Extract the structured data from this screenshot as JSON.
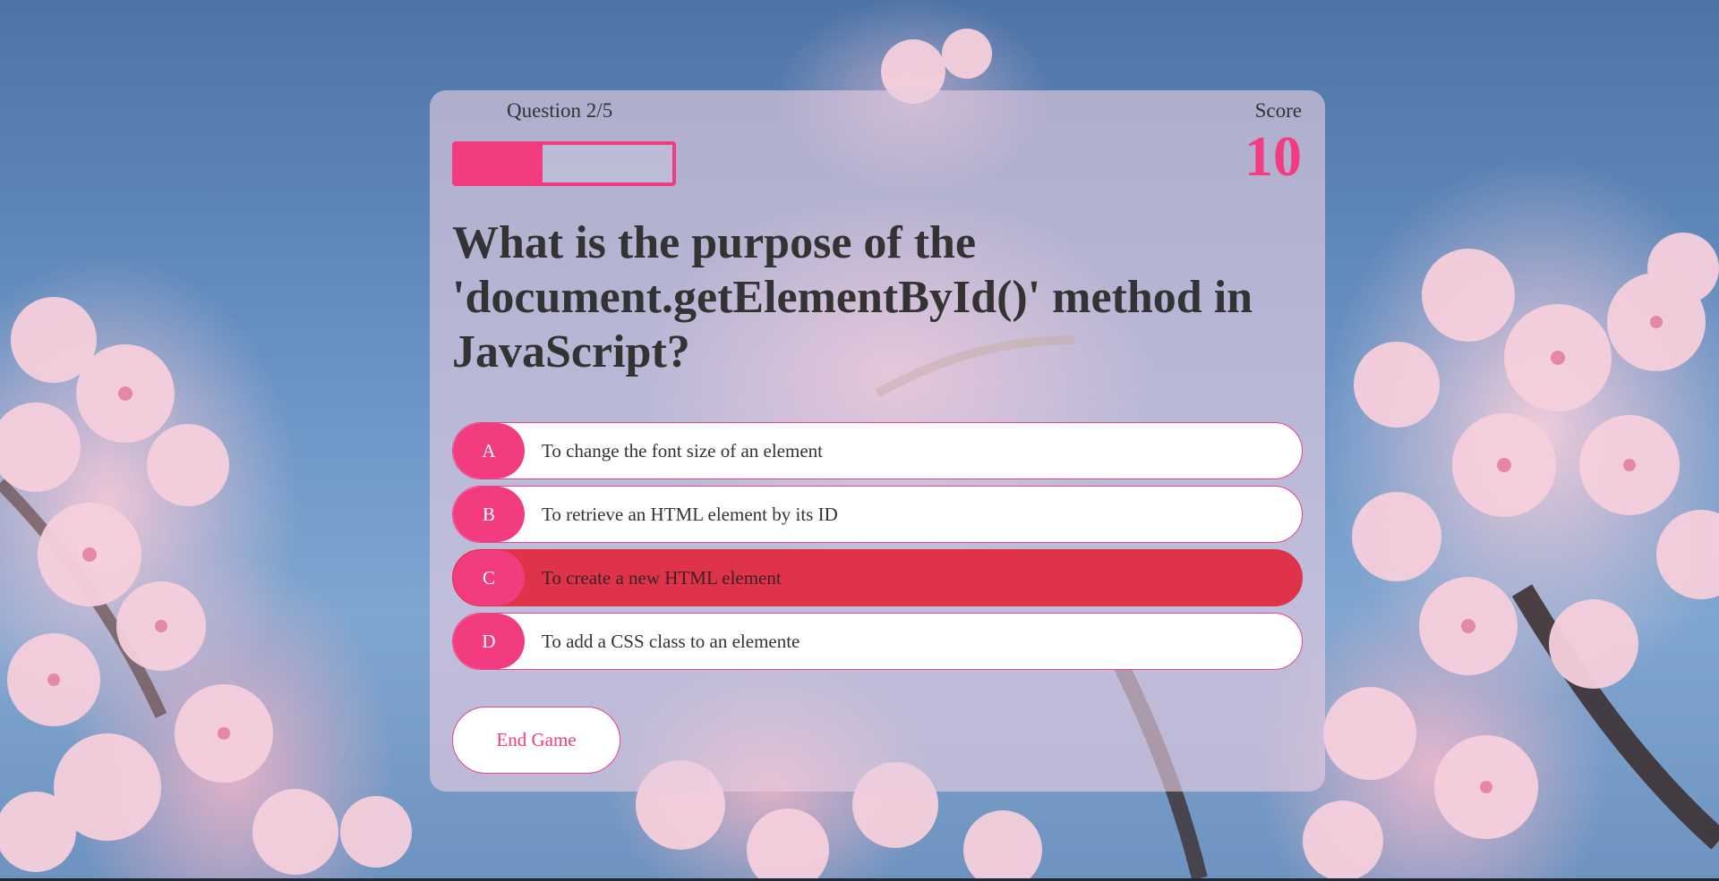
{
  "header": {
    "question_counter": "Question 2/5",
    "progress_fraction": 0.4,
    "score_label": "Score",
    "score_value": "10"
  },
  "question": {
    "text": "What is the purpose of the 'document.getElementById()' method in JavaScript?"
  },
  "choices": [
    {
      "prefix": "A",
      "text": "To change the font size of an element",
      "state": "default"
    },
    {
      "prefix": "B",
      "text": "To retrieve an HTML element by its ID",
      "state": "default"
    },
    {
      "prefix": "C",
      "text": "To create a new HTML element",
      "state": "incorrect"
    },
    {
      "prefix": "D",
      "text": "To add a CSS class to an elemente",
      "state": "default"
    }
  ],
  "actions": {
    "end_game_label": "End Game"
  },
  "colors": {
    "accent": "#f33b80",
    "incorrect": "#df3349",
    "text": "#333333"
  }
}
